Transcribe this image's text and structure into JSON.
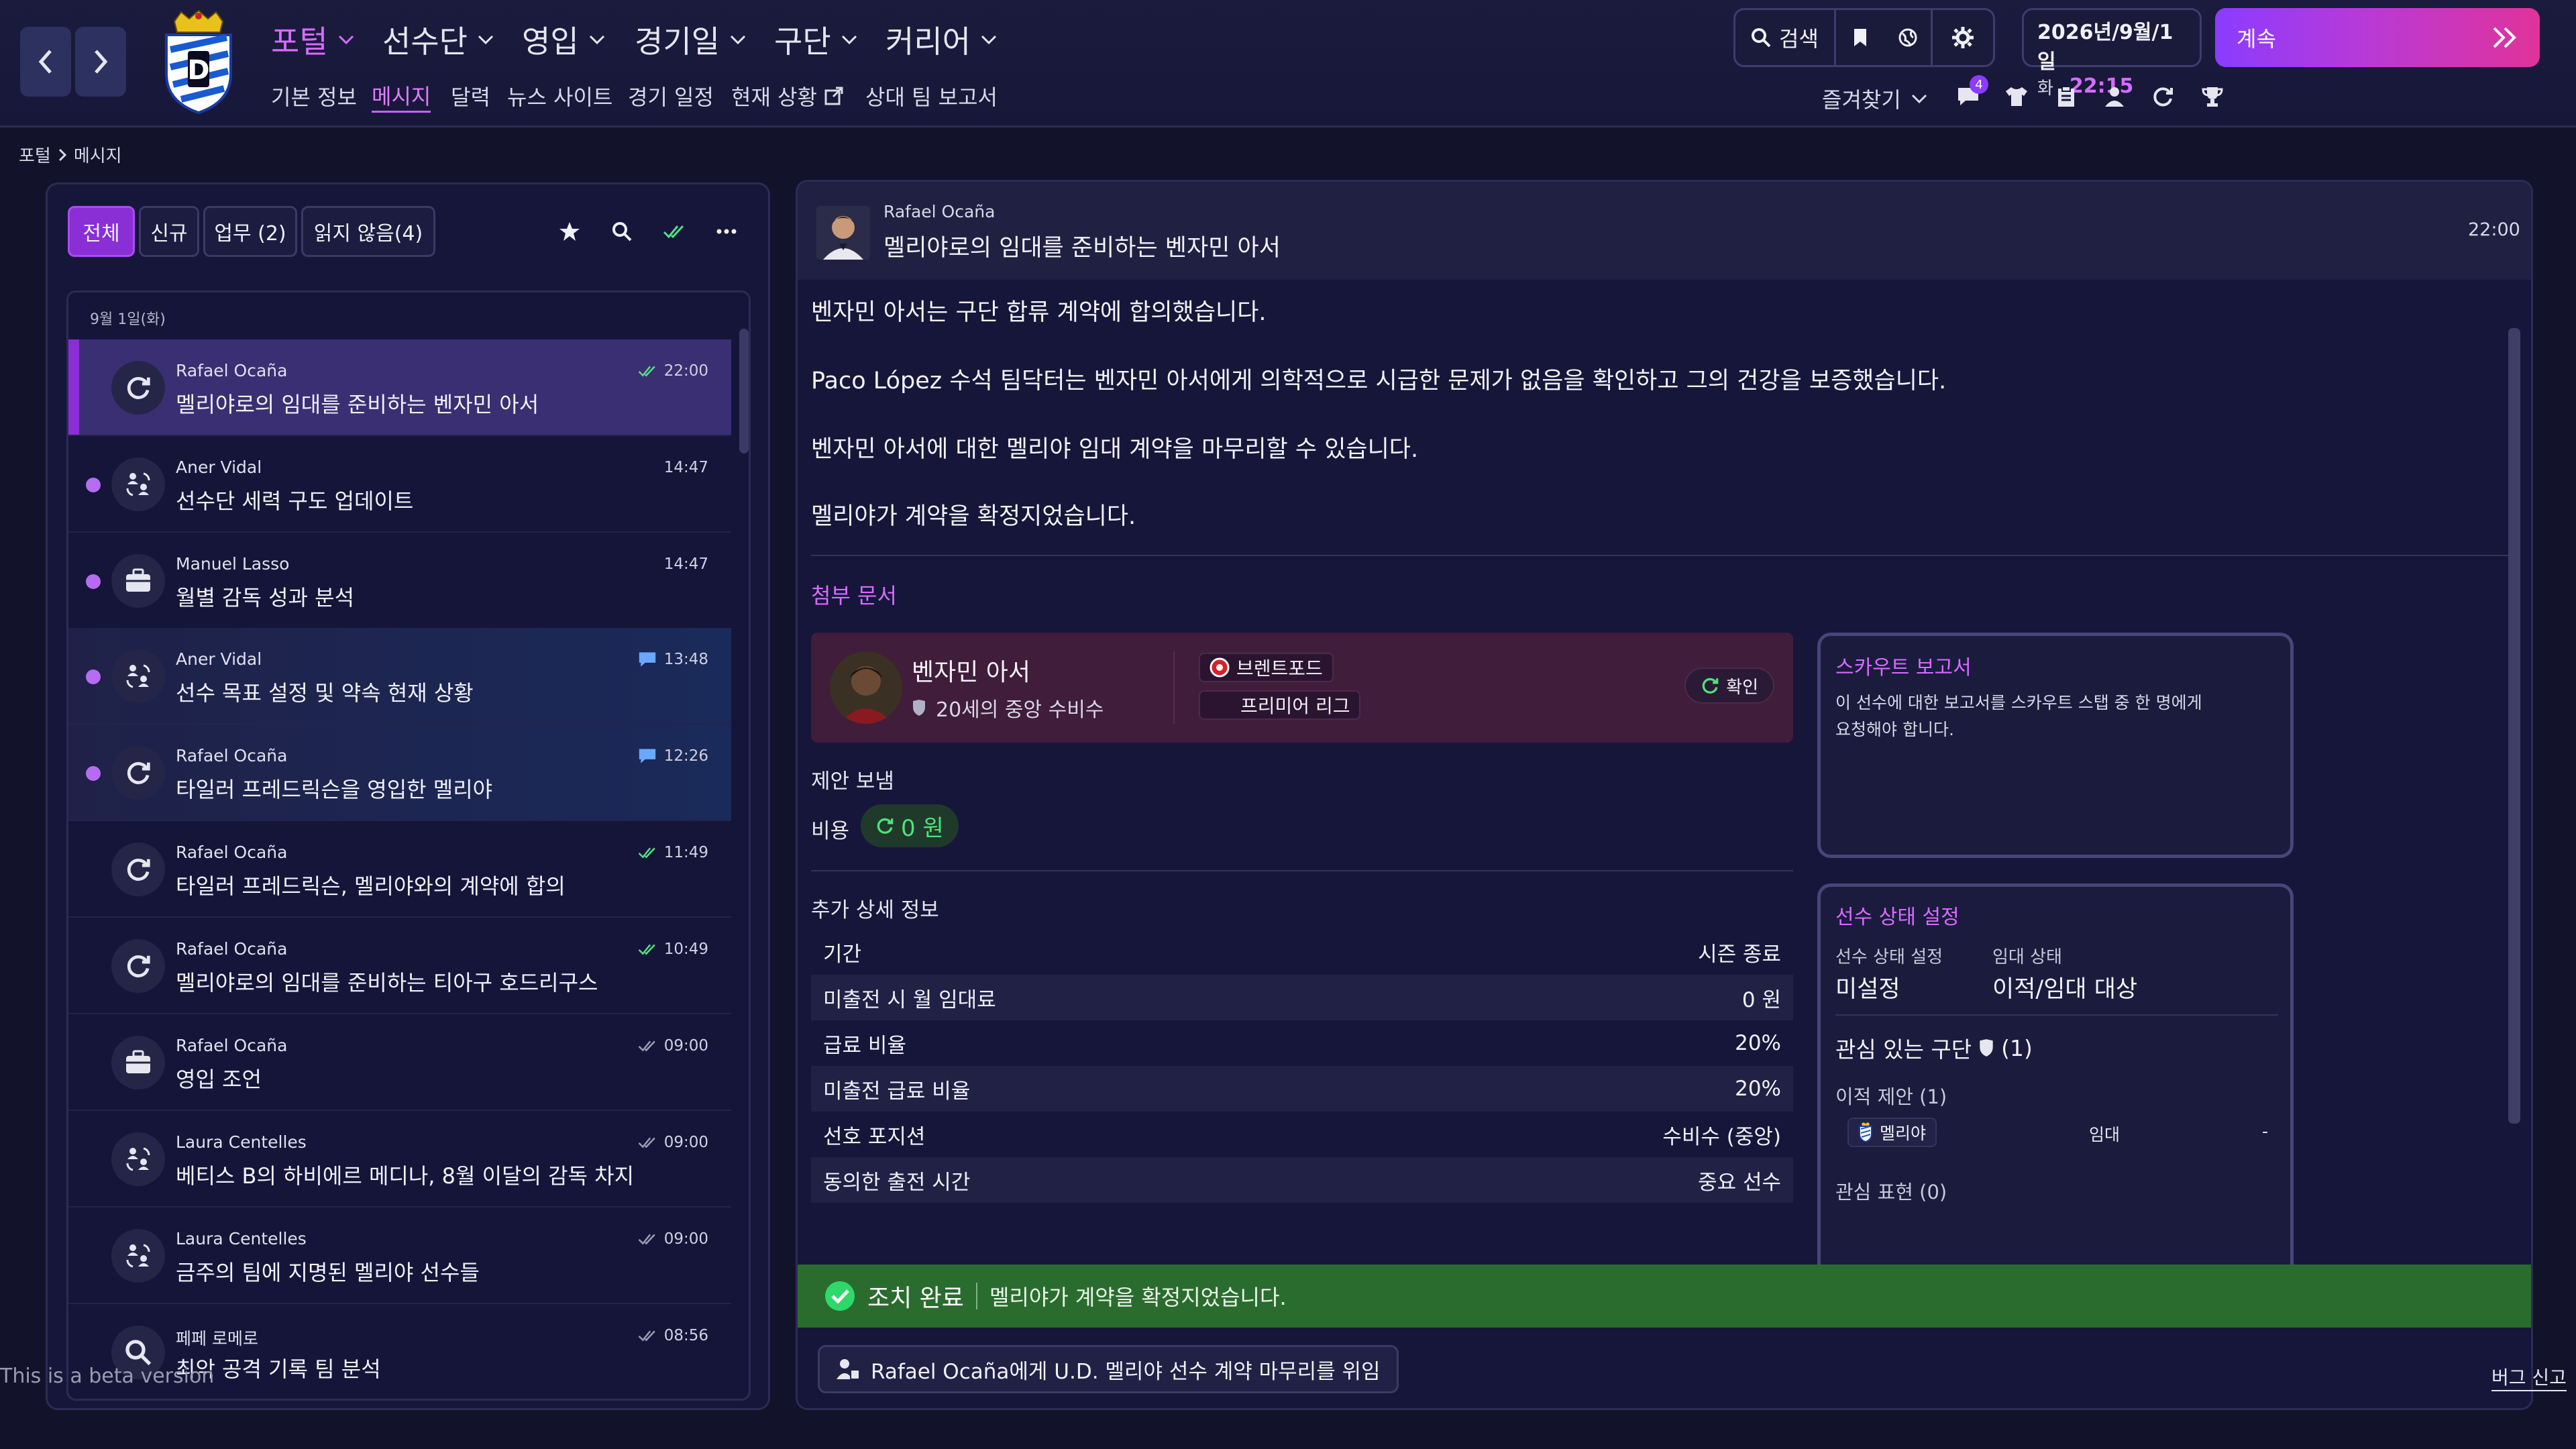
{
  "header": {
    "menu": [
      {
        "label": "포털",
        "active": true
      },
      {
        "label": "선수단"
      },
      {
        "label": "영입"
      },
      {
        "label": "경기일"
      },
      {
        "label": "구단"
      },
      {
        "label": "커리어"
      }
    ],
    "submenu": [
      {
        "label": "기본 정보"
      },
      {
        "label": "메시지",
        "active": true
      },
      {
        "label": "달력"
      },
      {
        "label": "뉴스 사이트"
      },
      {
        "label": "경기 일정"
      },
      {
        "label": "현재 상황"
      },
      {
        "label": "상대 팀 보고서"
      }
    ],
    "search_label": "검색",
    "date_main": "2026년/9월/1일",
    "weekday": "화",
    "time": "22:15",
    "continue_label": "계속",
    "favorites_label": "즐겨찾기",
    "notification_count": "4",
    "accent_color": "#d86bff"
  },
  "breadcrumb": {
    "root": "포털",
    "current": "메시지"
  },
  "inbox": {
    "filters": [
      {
        "label": "전체",
        "active": true
      },
      {
        "label": "신규"
      },
      {
        "label": "업무 (2)"
      },
      {
        "label": "읽지 않음(4)"
      }
    ],
    "date_header": "9월 1일(화)",
    "messages": [
      {
        "sender": "Rafael Ocaña",
        "subject": "멜리야로의 임대를 준비하는 벤자민 아서",
        "time": "22:00",
        "icon": "transfer-icon",
        "status": "read-check",
        "selected": true
      },
      {
        "sender": "Aner Vidal",
        "subject": "선수단 세력 구도 업데이트",
        "time": "14:47",
        "icon": "people-icon",
        "unread": true
      },
      {
        "sender": "Manuel Lasso",
        "subject": "월별 감독 성과 분석",
        "time": "14:47",
        "icon": "briefcase-icon",
        "unread": true
      },
      {
        "sender": "Aner Vidal",
        "subject": "선수 목표 설정 및 약속 현재 상황",
        "time": "13:48",
        "icon": "people-icon",
        "status": "chat",
        "unread": true,
        "highlight": true
      },
      {
        "sender": "Rafael Ocaña",
        "subject": "타일러 프레드릭슨을 영입한 멜리야",
        "time": "12:26",
        "icon": "transfer-icon",
        "status": "chat",
        "unread": true,
        "highlight": true
      },
      {
        "sender": "Rafael Ocaña",
        "subject": "타일러 프레드릭슨, 멜리야와의 계약에 합의",
        "time": "11:49",
        "icon": "transfer-icon",
        "status": "read-check"
      },
      {
        "sender": "Rafael Ocaña",
        "subject": "멜리야로의 임대를 준비하는 티아구 호드리구스",
        "time": "10:49",
        "icon": "transfer-icon",
        "status": "read-check"
      },
      {
        "sender": "Rafael Ocaña",
        "subject": "영입 조언",
        "time": "09:00",
        "icon": "briefcase-icon",
        "status": "grey-check"
      },
      {
        "sender": "Laura Centelles",
        "subject": "베티스 B의 하비에르 메디나, 8월 이달의 감독 차지",
        "time": "09:00",
        "icon": "people-icon",
        "status": "grey-check"
      },
      {
        "sender": "Laura Centelles",
        "subject": "금주의 팀에 지명된 멜리야 선수들",
        "time": "09:00",
        "icon": "people-icon",
        "status": "grey-check"
      },
      {
        "sender": "페페 로메로",
        "subject": "최악 공격 기록 팀 분석",
        "time": "08:56",
        "icon": "magnifier-icon",
        "status": "grey-check"
      }
    ]
  },
  "message": {
    "sender": "Rafael Ocaña",
    "subject": "멜리야로의 임대를 준비하는 벤자민 아서",
    "time": "22:00",
    "paragraphs": [
      "벤자민 아서는 구단 합류 계약에 합의했습니다.",
      "Paco López 수석 팀닥터는 벤자민 아서에게 의학적으로 시급한 문제가 없음을 확인하고 그의 건강을 보증했습니다.",
      "벤자민 아서에 대한 멜리야 임대 계약을 마무리할 수 있습니다.",
      "멜리야가 계약을 확정지었습니다."
    ],
    "attachment_title": "첨부 문서",
    "player": {
      "name": "벤자민 아서",
      "desc": "20세의 중앙 수비수",
      "club": "브렌트포드",
      "league": "프리미어 리그",
      "confirm_label": "확인"
    },
    "offer_sent": "제안 보냄",
    "fee_label": "비용",
    "fee_value": "0 원",
    "details_title": "추가 상세 정보",
    "details": [
      {
        "label": "기간",
        "value": "시즌 종료"
      },
      {
        "label": "미출전 시 월 임대료",
        "value": "0 원"
      },
      {
        "label": "급료 비율",
        "value": "20%"
      },
      {
        "label": "미출전 급료 비율",
        "value": "20%"
      },
      {
        "label": "선호 포지션",
        "value": "수비수 (중앙)"
      },
      {
        "label": "동의한 출전 시간",
        "value": "중요 선수"
      }
    ],
    "scout": {
      "title": "스카우트 보고서",
      "line1": "이 선수에 대한 보고서를 스카우트 스탭 중 한 명에게",
      "line2": "요청해야 합니다."
    },
    "status": {
      "title": "선수 상태 설정",
      "player_status_label": "선수 상태 설정",
      "player_status_value": "미설정",
      "loan_status_label": "임대 상태",
      "loan_status_value": "이적/임대 대상",
      "interested_clubs": "관심 있는 구단",
      "interested_count": "(1)",
      "transfer_offers": "이적 제안 (1)",
      "offer_club": "멜리야",
      "offer_type": "임대",
      "offer_extra": "-",
      "interest_expressed": "관심 표현 (0)"
    },
    "action_done": "조치 완료",
    "action_text": "멜리야가 계약을 확정지었습니다.",
    "delegate_label": "Rafael Ocaña에게 U.D. 멜리야 선수 계약 마무리를 위임"
  },
  "footer": {
    "beta": "This is a beta version",
    "bug_report": "버그 신고"
  }
}
